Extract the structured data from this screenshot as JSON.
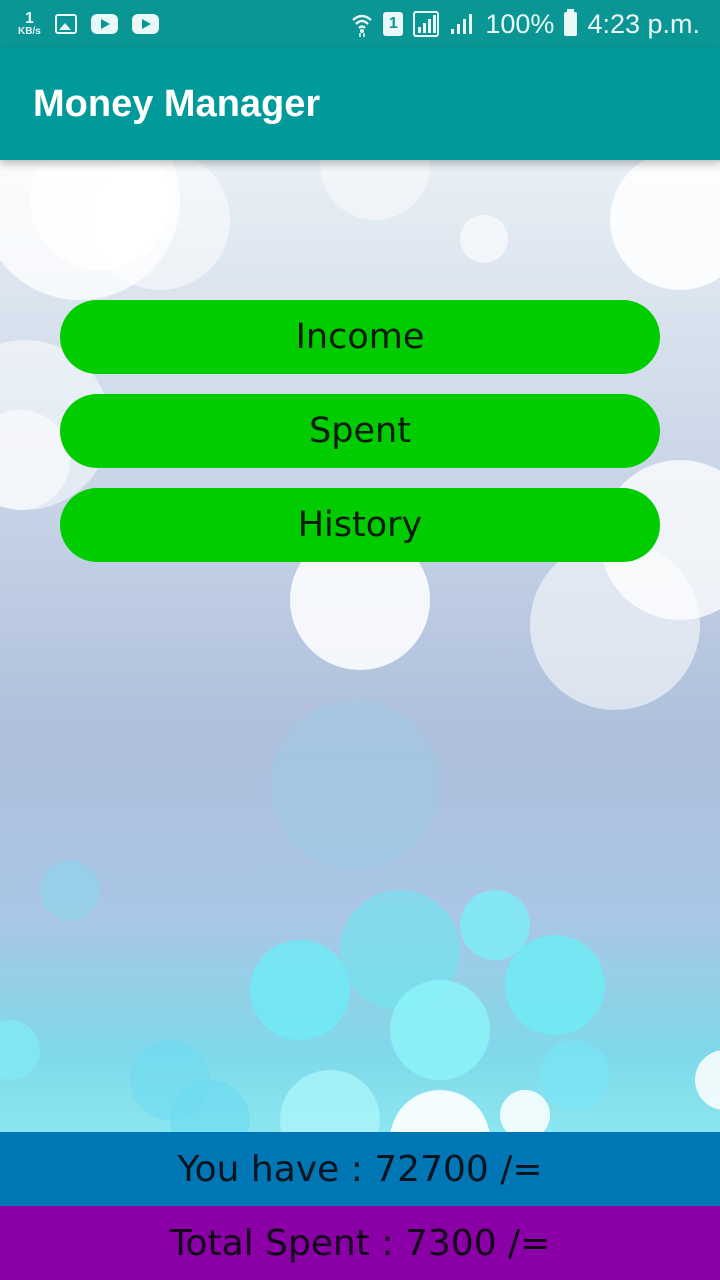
{
  "status_bar": {
    "network_speed_value": "1",
    "network_speed_unit": "KB/s",
    "sim_slot": "1",
    "battery": "100%",
    "time": "4:23 p.m."
  },
  "app_bar": {
    "title": "Money Manager",
    "color": "#009a9a"
  },
  "menu": {
    "income_label": "Income",
    "spent_label": "Spent",
    "history_label": "History",
    "button_color": "#00cc00"
  },
  "summary": {
    "you_have": "You have : 72700 /=",
    "total_spent": "Total Spent : 7300 /="
  }
}
